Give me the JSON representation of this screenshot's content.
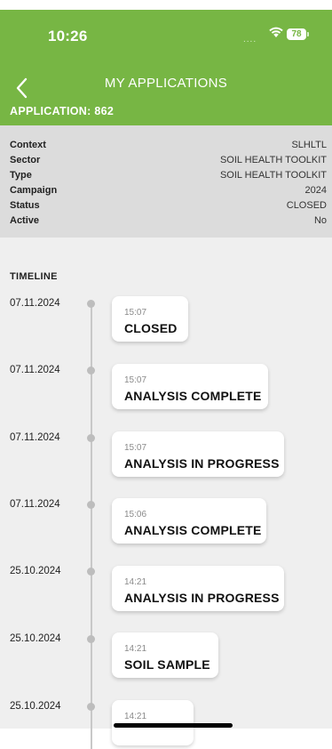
{
  "status_bar": {
    "time": "10:26",
    "signal": "....",
    "battery": "78"
  },
  "header": {
    "title": "MY APPLICATIONS",
    "application_label": "APPLICATION: 862"
  },
  "info": [
    {
      "key": "Context",
      "value": "SLHLTL"
    },
    {
      "key": "Sector",
      "value": "SOIL HEALTH TOOLKIT"
    },
    {
      "key": "Type",
      "value": "SOIL HEALTH TOOLKIT"
    },
    {
      "key": "Campaign",
      "value": "2024"
    },
    {
      "key": "Status",
      "value": "CLOSED"
    },
    {
      "key": "Active",
      "value": "No"
    }
  ],
  "timeline": {
    "title": "TIMELINE",
    "events": [
      {
        "date": "07.11.2024",
        "time": "15:07",
        "status": "CLOSED"
      },
      {
        "date": "07.11.2024",
        "time": "15:07",
        "status": "ANALYSIS COMPLETE"
      },
      {
        "date": "07.11.2024",
        "time": "15:07",
        "status": "ANALYSIS IN PROGRESS"
      },
      {
        "date": "07.11.2024",
        "time": "15:06",
        "status": "ANALYSIS COMPLETE"
      },
      {
        "date": "25.10.2024",
        "time": "14:21",
        "status": "ANALYSIS IN PROGRESS"
      },
      {
        "date": "25.10.2024",
        "time": "14:21",
        "status": "SOIL SAMPLE"
      },
      {
        "date": "25.10.2024",
        "time": "14:21",
        "status": ""
      }
    ]
  }
}
